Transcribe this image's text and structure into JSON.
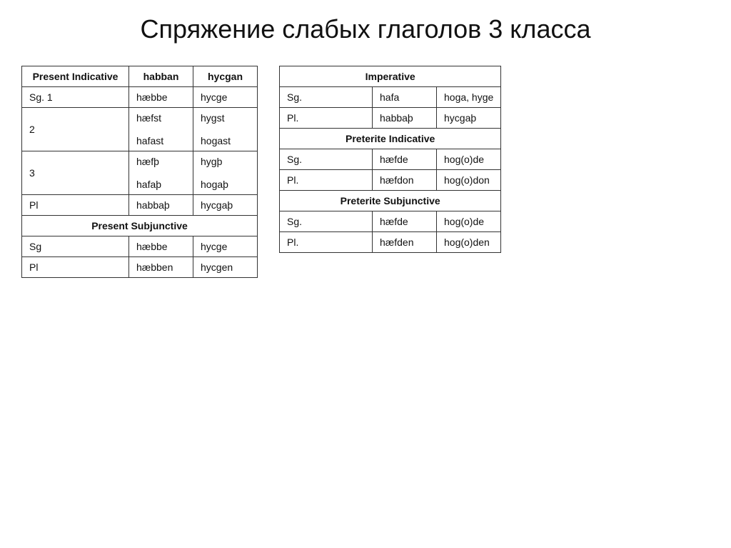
{
  "title": "Спряжение слабых глаголов 3 класса",
  "left_table": {
    "headers": [
      "Present Indicative",
      "habban",
      "hycgan"
    ],
    "rows": [
      {
        "label": "Sg. 1",
        "col1": "hæbbe",
        "col2": "hycge"
      },
      {
        "label": "2",
        "col1": "hæfst\n\nhafast",
        "col2": "hygst\n\nhogast"
      },
      {
        "label": "3",
        "col1": "hæfþ\n\nhafaþ",
        "col2": "hygþ\n\nhogaþ"
      },
      {
        "label": "Pl",
        "col1": "habbaþ",
        "col2": "hycgaþ"
      }
    ],
    "subjunctive_header": "Present Subjunctive",
    "subjunctive_rows": [
      {
        "label": "Sg",
        "col1": "hæbbe",
        "col2": "hycge"
      },
      {
        "label": "Pl",
        "col1": "hæbben",
        "col2": "hycgen"
      }
    ]
  },
  "right_table": {
    "imperative_header": "Imperative",
    "imperative_rows": [
      {
        "label": "Sg.",
        "col1": "hafa",
        "col2": "hoga, hyge"
      },
      {
        "label": "Pl.",
        "col1": "habbaþ",
        "col2": "hycgaþ"
      }
    ],
    "pret_ind_header": "Preterite Indicative",
    "pret_ind_rows": [
      {
        "label": "Sg.",
        "col1": "hæfde",
        "col2": "hog(o)de"
      },
      {
        "label": "Pl.",
        "col1": "hæfdon",
        "col2": "hog(o)don"
      }
    ],
    "pret_subj_header": "Preterite Subjunctive",
    "pret_subj_rows": [
      {
        "label": "Sg.",
        "col1": "hæfde",
        "col2": "hog(o)de"
      },
      {
        "label": "Pl.",
        "col1": "hæfden",
        "col2": "hog(o)den"
      }
    ]
  }
}
